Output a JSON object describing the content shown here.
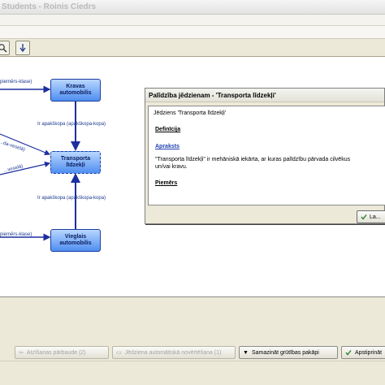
{
  "window": {
    "title": "Students - Roinis Ciedrs"
  },
  "diagram": {
    "nodes": {
      "kravas": "Kravas\nautomobilis",
      "transporta": "Transporta\nlīdzekļi",
      "vieglais": "Vieglais\nautomobilis"
    },
    "edge_labels": {
      "left_top": "piemērs-klase)",
      "vertical_top": "Ir apakškopa (apakškopa-kopa)",
      "diag_upper": "...da-veselā)",
      "diag_lower": "...veselā)",
      "vertical_bottom": "Ir apakškopa (apakškopa-kopa)",
      "left_bottom": "piemērs-klase)"
    }
  },
  "dialog": {
    "title": "Palīdzība jēdzienam - 'Transporta līdzekļi'",
    "term_line": "Jēdziens 'Transporta līdzekļi'",
    "section_definition": "Definīcija",
    "section_description": "Apraksts",
    "description_text": "\"Transporta līdzekļi\" ir mehāniskā iekārta, ar kuras palīdzību pārvada cilvēkus un/vai kravu.",
    "section_examples": "Piemērs",
    "ok_label": "La..."
  },
  "toolbar": {
    "zoom_icon": "zoom-icon",
    "pin_icon": "pin-icon"
  },
  "bottom_buttons": {
    "btn1": "Atzīšanas pārbaude (2)",
    "btn2": "Jēdziena automātiskā novērtēšana (1)",
    "btn3": "Samazināt grūtības pakāpi",
    "btn4": "Apstiprināt"
  },
  "colors": {
    "node_fill_top": "#b8d7ff",
    "node_fill_bottom": "#4f8ef0",
    "edge": "#1c2fa0"
  }
}
